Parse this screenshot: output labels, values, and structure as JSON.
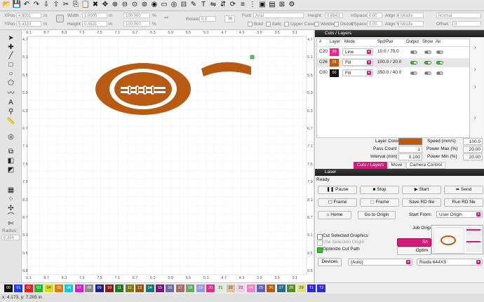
{
  "toolbar": {
    "icons": [
      "folder-open-icon",
      "save-icon",
      "undo-icon",
      "redo-icon",
      "import-icon",
      "export-icon",
      "cut-icon",
      "copy-icon",
      "paste-icon",
      "delete-icon",
      "move-icon",
      "zoom-in-icon",
      "zoom-out-icon",
      "zoom-frame-icon",
      "zoom-fit-icon",
      "camera-icon",
      "monitor-icon",
      "ellipse-tool-icon",
      "tab-tool-icon",
      "pen-icon",
      "text-icon",
      "flip-h-icon",
      "flip-v-icon",
      "rotate-icon",
      "align-icon",
      "distribute-icon",
      "group-icon",
      "ungroup-icon",
      "weld-icon",
      "settings-icon"
    ]
  },
  "options": {
    "xpos_label": "XPos",
    "xpos_value": "4.8031",
    "ypos_label": "YPos",
    "ypos_value": "5.4333",
    "unit": "in",
    "width_label": "Width",
    "width_value": "1.0905",
    "height_label": "Height",
    "height_value": "0.4521",
    "scale_w": "100.000",
    "scale_h": "100.000",
    "pct": "%",
    "rotate_label": "Rotate",
    "rotate_value": "0.0",
    "rotate_unit": "in",
    "font_label": "Font",
    "font_value": "Arial",
    "text_height_label": "Height",
    "text_height_value": "0.8643",
    "hspace_label": "HSpace",
    "hspace_value": "0.00",
    "vspace_label": "VSpace",
    "vspace_value": "0.00",
    "alignx_label": "Align X",
    "alignx_value": "Middle",
    "aligny_label": "Align Y",
    "aligny_value": "Middle",
    "normal_value": "Normal",
    "offset_label": "Offset",
    "offset_value": "0",
    "bold": "Bold",
    "italic": "Italic",
    "upper": "Upper Case",
    "welded": "Welded",
    "distort": "Distort"
  },
  "left_tools": {
    "icons": [
      "select-arrow-icon",
      "edit-nodes-icon",
      "line-tool-icon",
      "rect-tool-icon",
      "ellipse-icon",
      "polygon-icon",
      "polyline-icon",
      "text-tool-icon",
      "position-pin-icon",
      "measure-icon",
      "offset-icon",
      "boolean-union-icon",
      "boolean-subtract-icon",
      "boolean-intersect-icon",
      "array-icon",
      "grid-array-icon",
      "circular-array-icon",
      "rounded-corner-icon",
      "trim-icon"
    ],
    "radius_label": "Radius:",
    "radius_value": "0.394"
  },
  "ruler": {
    "top_ticks": [
      "9.1",
      "8.7",
      "8.3",
      "7.9",
      "7.5",
      "7.1",
      "6.7",
      "6.3",
      "5.9",
      "5.5",
      "5.1",
      "4.7",
      "4.3",
      "3.9",
      "3.5",
      "3.1"
    ],
    "side_ticks": [
      "4.7",
      "5.1",
      "5.5",
      "5.9",
      "6.3",
      "6.7",
      "7.1",
      "7.5",
      "7.9",
      "8.3",
      "8.7",
      "9.1",
      "9.5",
      "9.8"
    ]
  },
  "cuts_panel": {
    "title": "Cuts / Layers",
    "headers": [
      "#",
      "Layer",
      "Mode",
      "Spd/Pwr",
      "Output",
      "Show",
      "Air"
    ],
    "rows": [
      {
        "id": "C20",
        "layer": "20",
        "color": "#e8288c",
        "mode": "Line",
        "spd": "10.0 / 70.0",
        "output": false,
        "show": false,
        "air": false
      },
      {
        "id": "C26",
        "layer": "26",
        "color": "#b85a12",
        "mode": "Fill",
        "spd": "100.0 / 20.0",
        "output": true,
        "show": true,
        "air": true
      },
      {
        "id": "C00",
        "layer": "00",
        "color": "#111111",
        "mode": "Fill",
        "spd": "350.0 / 40.0",
        "output": false,
        "show": false,
        "air": false
      }
    ],
    "layer_color_label": "Layer Color",
    "layer_color": "#b85a12",
    "pass_count_label": "Pass Count",
    "pass_count": "1",
    "interval_label": "Interval (mm)",
    "interval": "0.100",
    "speed_label": "Speed (mm/s)",
    "speed": "100.0",
    "power_max_label": "Power Max (%)",
    "power_max": "20.00",
    "power_min_label": "Power Min (%)",
    "power_min": "20.00",
    "tabs": [
      "Cuts / Layers",
      "Move",
      "Camera Control"
    ]
  },
  "laser_panel": {
    "title": "Laser",
    "status": "Ready",
    "pause": "Pause",
    "stop": "Stop",
    "start": "Start",
    "send": "Send",
    "frame1": "Frame",
    "frame2": "Frame",
    "save_rd": "Save RD file",
    "run_rd": "Run RD file",
    "home": "Home",
    "go_origin": "Go to Origin",
    "start_from_label": "Start From:",
    "start_from_value": "User Origin",
    "job_origin_label": "Job Origi",
    "cut_selected": "Cut Selected Graphics",
    "use_selection_origin": "Use Selection Origin",
    "optimize_cut": "Optimize Cut Path",
    "show_btn": "Sh",
    "optimize_btn": "Optim",
    "devices": "Devices",
    "device_value": "(Auto)",
    "controller_value": "Ruida 644XS"
  },
  "palette": {
    "labels": [
      "00",
      "01",
      "02",
      "03",
      "04",
      "05",
      "06",
      "07",
      "08",
      "09",
      "10",
      "11",
      "12",
      "13",
      "14",
      "15",
      "16",
      "17",
      "18",
      "19",
      "20",
      "21",
      "22",
      "23",
      "24",
      "25",
      "26",
      "27",
      "28",
      "29",
      "T1",
      "T2"
    ],
    "colors": [
      "#111111",
      "#1a3fe0",
      "#e41b1b",
      "#22b822",
      "#d8d817",
      "#e07a12",
      "#17c9d6",
      "#d21bd2",
      "#8a8a8a",
      "#1c1c8a",
      "#8b1a1a",
      "#1f7a1f",
      "#7a7a14",
      "#9a5512",
      "#14787a",
      "#7a147a",
      "#6a6aa8",
      "#a86a6a",
      "#6aa86a",
      "#9898e0",
      "#e8288c",
      "#d8f0d0",
      "#e0c0a0",
      "#f0d0f0",
      "#f080c8",
      "#6060c0",
      "#b85a12",
      "#2a6a8a",
      "#5a8a2a",
      "#e0e07a",
      "#2a2ad6",
      "#2a2ad6"
    ]
  },
  "statusbar": {
    "coords": "x: 4.173, y: 7.205 in"
  }
}
